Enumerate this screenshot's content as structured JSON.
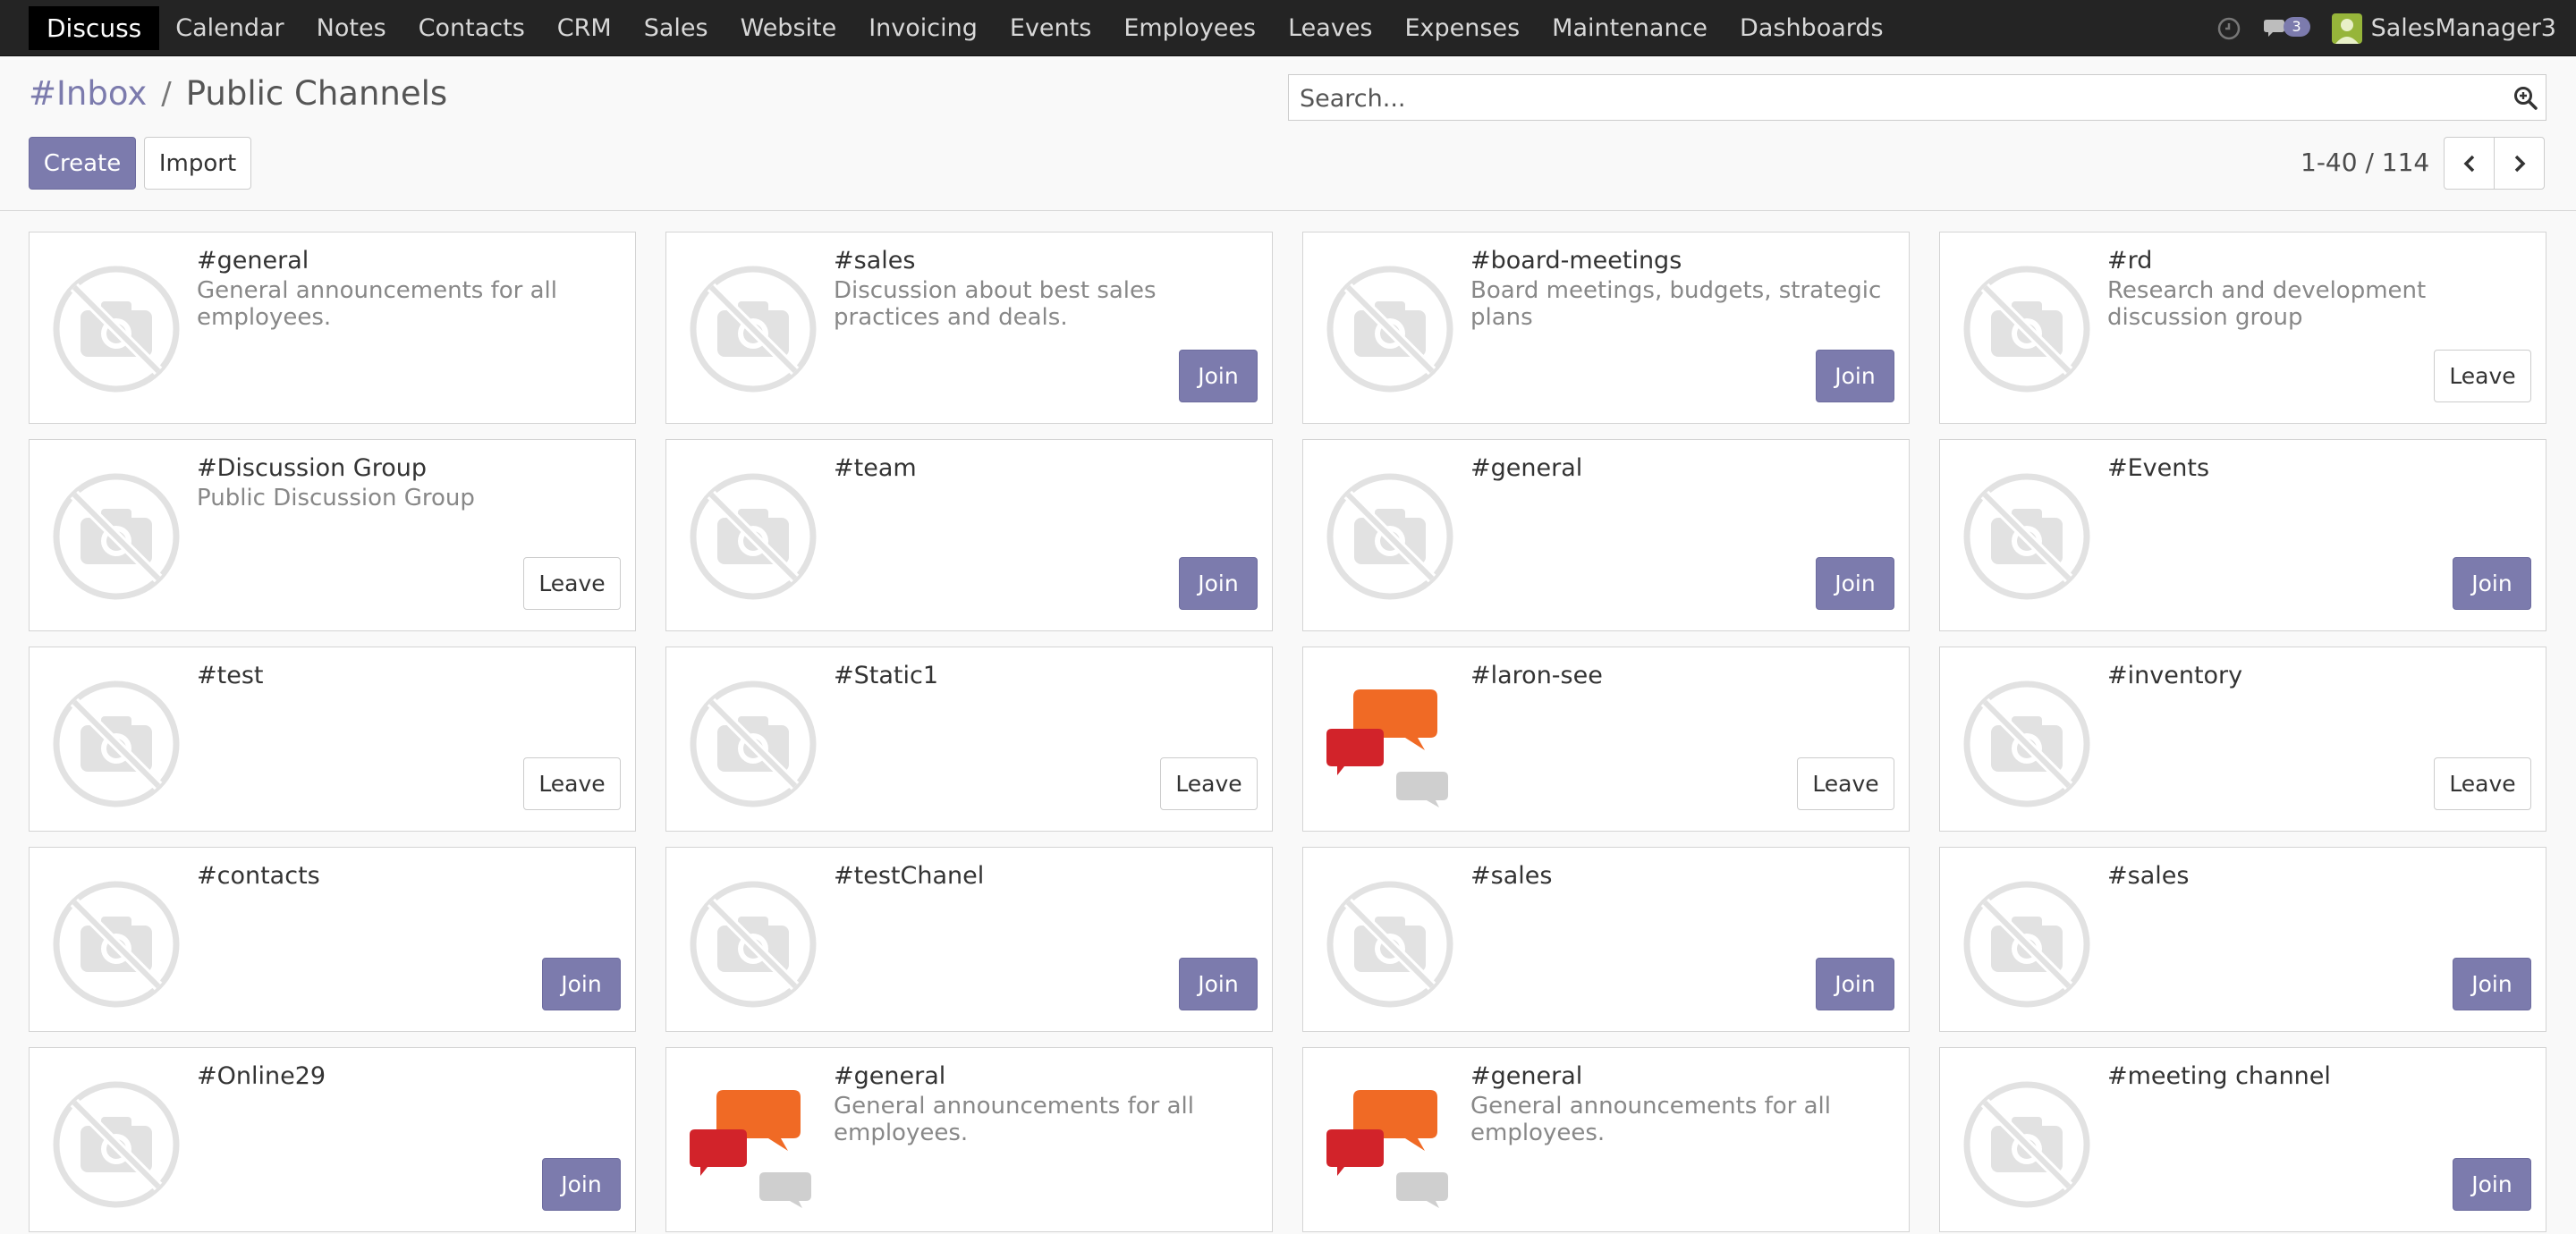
{
  "navbar": {
    "brand": "Discuss",
    "menu": [
      "Calendar",
      "Notes",
      "Contacts",
      "CRM",
      "Sales",
      "Website",
      "Invoicing",
      "Events",
      "Employees",
      "Leaves",
      "Expenses",
      "Maintenance",
      "Dashboards"
    ],
    "messages_badge": "3",
    "user_name": "SalesManager3",
    "icons": [
      "clock-icon",
      "chat-icon",
      "avatar"
    ],
    "colors": {
      "background": "#242424",
      "brand_bg": "#000000"
    }
  },
  "control_panel": {
    "breadcrumb_root": "#Inbox",
    "breadcrumb_separator": "/",
    "breadcrumb_current": "Public Channels",
    "create_label": "Create",
    "import_label": "Import",
    "search_placeholder": "Search...",
    "pager_value": "1-40 / 114"
  },
  "colors": {
    "accent": "#7c7bad"
  },
  "channels": [
    {
      "name": "#general",
      "description": "General announcements for all employees.",
      "image": "placeholder",
      "action": ""
    },
    {
      "name": "#sales",
      "description": "Discussion about best sales practices and deals.",
      "image": "placeholder",
      "action": "Join"
    },
    {
      "name": "#board-meetings",
      "description": "Board meetings, budgets, strategic plans",
      "image": "placeholder",
      "action": "Join"
    },
    {
      "name": "#rd",
      "description": "Research and development discussion group",
      "image": "placeholder",
      "action": "Leave"
    },
    {
      "name": "#Discussion Group",
      "description": "Public Discussion Group",
      "image": "placeholder",
      "action": "Leave"
    },
    {
      "name": "#team",
      "description": "",
      "image": "placeholder",
      "action": "Join"
    },
    {
      "name": "#general",
      "description": "",
      "image": "placeholder",
      "action": "Join"
    },
    {
      "name": "#Events",
      "description": "",
      "image": "placeholder",
      "action": "Join"
    },
    {
      "name": "#test",
      "description": "",
      "image": "placeholder",
      "action": "Leave"
    },
    {
      "name": "#Static1",
      "description": "",
      "image": "placeholder",
      "action": "Leave"
    },
    {
      "name": "#laron-see",
      "description": "",
      "image": "bubbles",
      "action": "Leave"
    },
    {
      "name": "#inventory",
      "description": "",
      "image": "placeholder",
      "action": "Leave"
    },
    {
      "name": "#contacts",
      "description": "",
      "image": "placeholder",
      "action": "Join"
    },
    {
      "name": "#testChanel",
      "description": "",
      "image": "placeholder",
      "action": "Join"
    },
    {
      "name": "#sales",
      "description": "",
      "image": "placeholder",
      "action": "Join"
    },
    {
      "name": "#sales",
      "description": "",
      "image": "placeholder",
      "action": "Join"
    },
    {
      "name": "#Online29",
      "description": "",
      "image": "placeholder",
      "action": "Join"
    },
    {
      "name": "#general",
      "description": "General announcements for all employees.",
      "image": "bubbles",
      "action": ""
    },
    {
      "name": "#general",
      "description": "General announcements for all employees.",
      "image": "bubbles",
      "action": ""
    },
    {
      "name": "#meeting channel",
      "description": "",
      "image": "placeholder",
      "action": "Join"
    }
  ]
}
